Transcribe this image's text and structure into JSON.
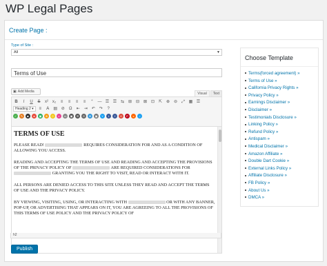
{
  "page": {
    "title": "WP Legal Pages"
  },
  "panel": {
    "header": "Create Page :"
  },
  "form": {
    "type_label": "Type of Site :",
    "type_value": "All",
    "page_title_value": "Terms of Use"
  },
  "editor": {
    "add_media_label": "Add Media",
    "tab_visual": "Visual",
    "tab_text": "Text",
    "format_select": "Heading 2",
    "status_path": "h2",
    "toolbar_row1": [
      "B",
      "I",
      "U",
      "S",
      "x²",
      "x₂",
      "≡",
      "≡",
      "≡",
      "≡",
      "“",
      "—",
      "☰",
      "☰",
      "⇆",
      "⊞",
      "⊟",
      "⊠",
      "⊡",
      "⇱",
      "⊕",
      "⊖",
      "⤢",
      "▦",
      "☰"
    ],
    "toolbar_row3": [
      "✓",
      "✎",
      "■",
      "●",
      "▣",
      "⊕",
      "⓪",
      "◐",
      "▭",
      "▣",
      "☰",
      "⊙",
      "⊕",
      "▣",
      "Y",
      "t",
      "f",
      "G",
      "P",
      "s",
      "♪"
    ],
    "content": {
      "heading": "TERMS OF USE",
      "p1_a": "PLEASE READ!",
      "p1_b": "REQUIRES CONSIDERATION FOR AND AS A CONDITION OF ALLOWING YOU ACCESS.",
      "p2_a": "READING AND ACCEPTING THE TERMS OF USE AND READING AND ACCEPTING THE PROVISIONS OF THE PRIVACY POLICY OF",
      "p2_b": "ARE REQUIRED CONSIDERATIONS FOR",
      "p2_c": "GRANTING YOU THE RIGHT TO VISIT, READ OR INTERACT WITH IT.",
      "p3": "ALL PERSONS ARE DENIED ACCESS TO THIS SITE UNLESS THEY READ AND ACCEPT THE TERMS OF USE AND THE PRIVACY POLICY.",
      "p4_a": "BY VIEWING, VISITING, USING, OR INTERACTING WITH",
      "p4_b": "OR WITH ANY BANNER, POP-UP, OR ADVERTISING THAT APPEARS ON IT, YOU ARE AGREEING TO ALL THE PROVISIONS OF THIS TERMS OF USE POLICY AND THE PRIVACY POLICY OF"
    }
  },
  "publish_label": "Publish",
  "sidebar": {
    "title": "Choose Template",
    "items": [
      "Terms(forced agreement) »",
      "Terms of Use »",
      "California Privacy Rights »",
      "Privacy Policy »",
      "Earnings Disclaimer »",
      "Disclaimer »",
      "Testimonials Disclosure »",
      "Linking Policy »",
      "Refund Policy »",
      "Antispam »",
      "Medical Disclaimer »",
      "Amazon Affiliate »",
      "Double Dart Cookie »",
      "External Links Policy »",
      "Affiliate Disclosure »",
      "FB Policy »",
      "About Us »",
      "DMCA »"
    ]
  },
  "colors": {
    "accent": "#0073aa",
    "background": "#f1f1f1"
  }
}
